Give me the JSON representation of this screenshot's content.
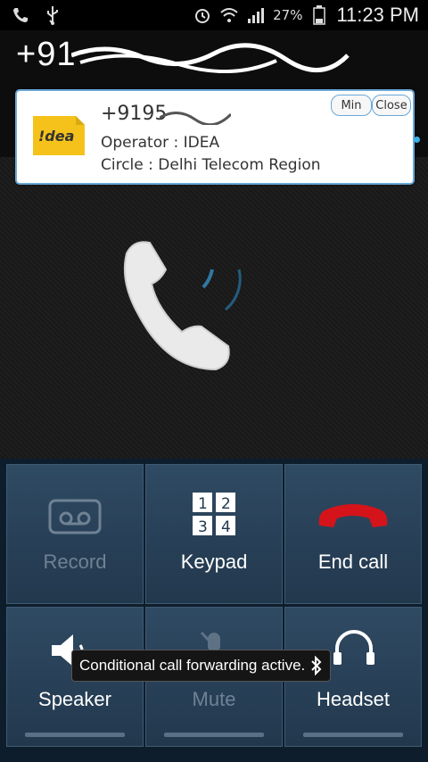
{
  "status_bar": {
    "battery_percent": "27%",
    "time": "11:23 PM",
    "icons": [
      "phone-icon",
      "usb-icon",
      "alarm-icon",
      "wifi-icon",
      "signal-icon",
      "battery-icon"
    ]
  },
  "call": {
    "number_display": "+91 "
  },
  "popup": {
    "number": "+9195",
    "operator": "Operator : IDEA",
    "circle": "Circle : Delhi Telecom Region",
    "logo_text": "!dea",
    "min_label": "Min",
    "close_label": "Close"
  },
  "buttons": {
    "record": "Record",
    "keypad": "Keypad",
    "end_call": "End call",
    "speaker": "Speaker",
    "mute": "Mute",
    "headset": "Headset",
    "keypad_digits": [
      "1",
      "2",
      "3",
      "4"
    ]
  },
  "toast": {
    "text": "Conditional call forwarding active."
  },
  "colors": {
    "end_call_red": "#d4141a",
    "popup_border": "#6aa8d8",
    "tile_bg": "#2f4a63"
  }
}
